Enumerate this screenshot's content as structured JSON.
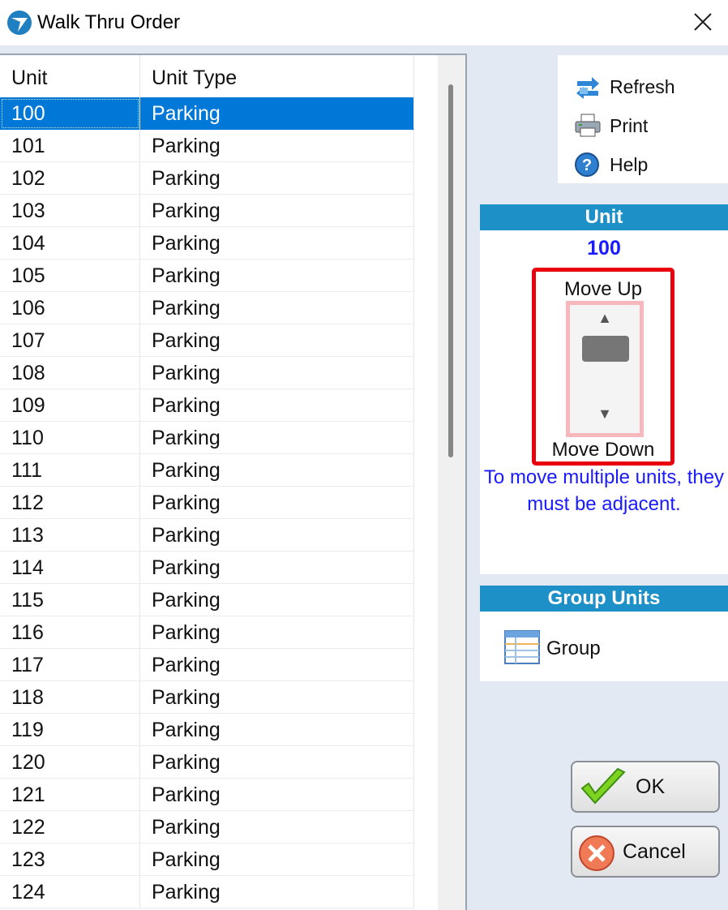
{
  "window": {
    "title": "Walk Thru Order"
  },
  "grid": {
    "columns": [
      "Unit",
      "Unit Type"
    ],
    "rows": [
      {
        "unit": "100",
        "type": "Parking",
        "selected": true
      },
      {
        "unit": "101",
        "type": "Parking"
      },
      {
        "unit": "102",
        "type": "Parking"
      },
      {
        "unit": "103",
        "type": "Parking"
      },
      {
        "unit": "104",
        "type": "Parking"
      },
      {
        "unit": "105",
        "type": "Parking"
      },
      {
        "unit": "106",
        "type": "Parking"
      },
      {
        "unit": "107",
        "type": "Parking"
      },
      {
        "unit": "108",
        "type": "Parking"
      },
      {
        "unit": "109",
        "type": "Parking"
      },
      {
        "unit": "110",
        "type": "Parking"
      },
      {
        "unit": "111",
        "type": "Parking"
      },
      {
        "unit": "112",
        "type": "Parking"
      },
      {
        "unit": "113",
        "type": "Parking"
      },
      {
        "unit": "114",
        "type": "Parking"
      },
      {
        "unit": "115",
        "type": "Parking"
      },
      {
        "unit": "116",
        "type": "Parking"
      },
      {
        "unit": "117",
        "type": "Parking"
      },
      {
        "unit": "118",
        "type": "Parking"
      },
      {
        "unit": "119",
        "type": "Parking"
      },
      {
        "unit": "120",
        "type": "Parking"
      },
      {
        "unit": "121",
        "type": "Parking"
      },
      {
        "unit": "122",
        "type": "Parking"
      },
      {
        "unit": "123",
        "type": "Parking"
      },
      {
        "unit": "124",
        "type": "Parking"
      }
    ]
  },
  "toolbar": {
    "refresh_label": "Refresh",
    "print_label": "Print",
    "help_label": "Help"
  },
  "unit_panel": {
    "header": "Unit",
    "current_unit": "100",
    "move_up_label": "Move Up",
    "move_down_label": "Move Down",
    "note": "To move multiple units, they must be adjacent."
  },
  "group_panel": {
    "header": "Group Units",
    "group_label": "Group"
  },
  "buttons": {
    "ok_label": "OK",
    "cancel_label": "Cancel"
  },
  "colors": {
    "panel_header": "#1e90c8",
    "selection": "#0078d7",
    "highlight_border": "#e8000f",
    "unit_text": "#1a1aff"
  }
}
